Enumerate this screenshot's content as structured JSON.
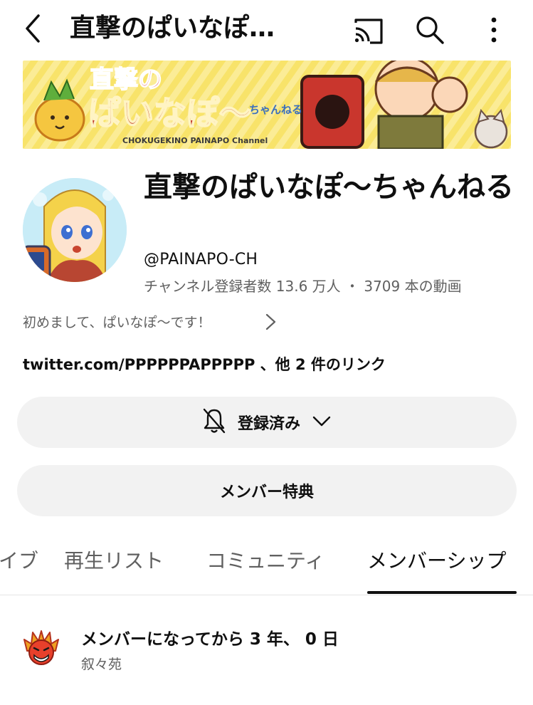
{
  "header": {
    "title": "直撃のぱいなぽ…",
    "icons": [
      "back-arrow-icon",
      "cast-icon",
      "search-icon",
      "more-vert-icon"
    ]
  },
  "banner": {
    "title_line1": "直撃の",
    "title_line2": "ぱいなぽ〜",
    "title_suffix": "ちゃんねる",
    "subtitle": "CHOKUGEKINO PAINAPO Channel"
  },
  "channel": {
    "name": "直撃のぱいなぽ〜ちゃんねる",
    "handle": "@PAINAPO-CH",
    "stats": "チャンネル登録者数 13.6 万人 ・ 3709 本の動画",
    "description": "初めまして、ぱいなぽ〜です！",
    "links": "twitter.com/PPPPPPAPPPPP 、他 2 件のリンク"
  },
  "buttons": {
    "subscribed": "登録済み",
    "membership_perks": "メンバー特典"
  },
  "tabs": [
    {
      "label": "イブ"
    },
    {
      "label": "再生リスト"
    },
    {
      "label": "コミュニティ"
    },
    {
      "label": "メンバーシップ",
      "active": true
    }
  ],
  "membership": {
    "title": "メンバーになってから 3 年、 0 日",
    "name": "叙々苑"
  },
  "colors": {
    "text": "#0f0f0f",
    "secondary": "#606060",
    "button_bg": "#f2f2f2",
    "banner_bg": "#f6e05a"
  }
}
